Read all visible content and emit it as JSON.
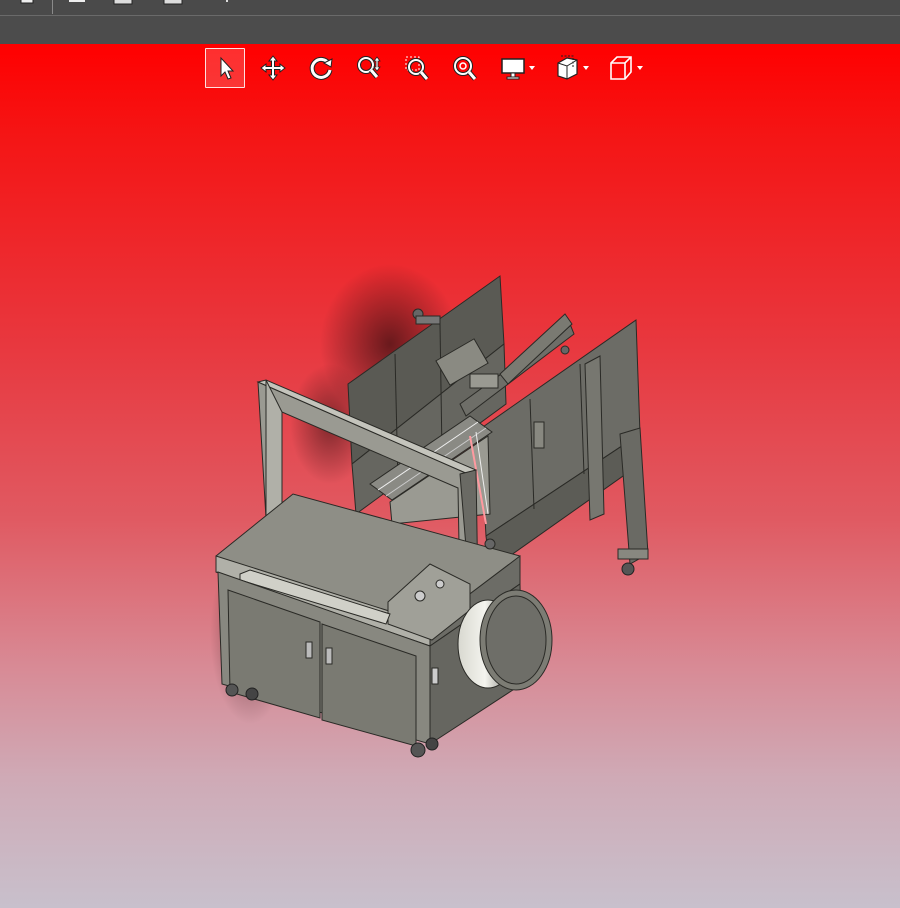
{
  "app": {
    "toolbar_icons": [
      "new-document-icon",
      "save-icon",
      "print-icon",
      "options-icon"
    ]
  },
  "view_toolbar": {
    "buttons": [
      {
        "name": "select-tool",
        "icon": "cursor-arrow-icon",
        "active": true
      },
      {
        "name": "pan-tool",
        "icon": "move-arrows-icon",
        "active": false
      },
      {
        "name": "rotate-tool",
        "icon": "rotate-icon",
        "active": false
      },
      {
        "name": "zoom-tool",
        "icon": "zoom-in-out-icon",
        "active": false
      },
      {
        "name": "zoom-area-tool",
        "icon": "zoom-window-icon",
        "active": false
      },
      {
        "name": "zoom-fit-tool",
        "icon": "zoom-fit-icon",
        "active": false
      },
      {
        "name": "display-style",
        "icon": "monitor-icon",
        "active": false,
        "has_dropdown": true
      },
      {
        "name": "section-view",
        "icon": "section-icon",
        "active": false,
        "has_dropdown": true
      },
      {
        "name": "view-orientation",
        "icon": "cube-icon",
        "active": false,
        "has_dropdown": true
      }
    ]
  },
  "colors": {
    "toolbar_bg": "#4a4a4a",
    "viewport_top": "#ff0000",
    "viewport_bottom": "#c8c0cc",
    "model_body": "#7a7a72",
    "model_dark": "#4e4e48",
    "model_light": "#a8a8a0"
  }
}
